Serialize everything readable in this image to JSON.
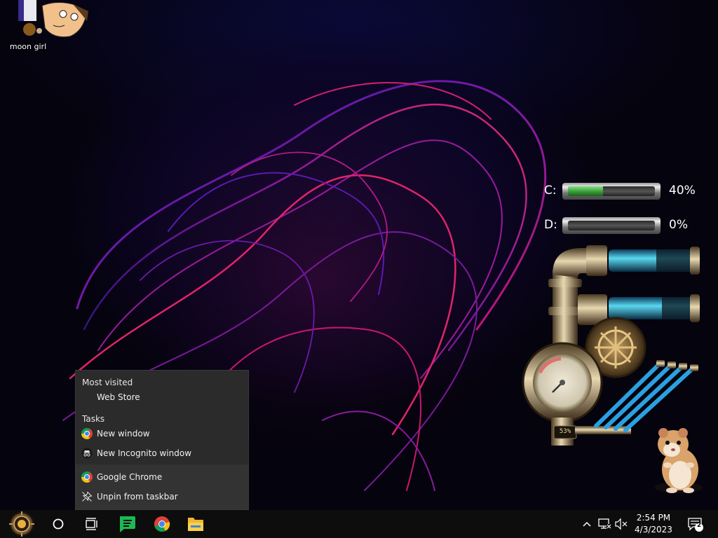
{
  "desktop": {
    "icons": [
      {
        "label": "moon girl",
        "icon": "cartoon-character-icon"
      }
    ]
  },
  "drives": [
    {
      "letter": "C:",
      "percent_text": "40%",
      "used_fraction": 0.4
    },
    {
      "letter": "D:",
      "percent_text": "0%",
      "used_fraction": 0.0
    }
  ],
  "gadget": {
    "readout": "53%"
  },
  "jumplist": {
    "most_visited_heading": "Most visited",
    "most_visited": [
      {
        "label": "Web Store"
      }
    ],
    "tasks_heading": "Tasks",
    "tasks": [
      {
        "label": "New window",
        "icon": "chrome-icon"
      },
      {
        "label": "New Incognito window",
        "icon": "incognito-icon"
      }
    ],
    "app_label": "Google Chrome",
    "unpin_label": "Unpin from taskbar"
  },
  "taskbar": {
    "start_icon": "steampunk-start-orb-icon",
    "search_icon": "cortana-circle-icon",
    "taskview_icon": "task-view-icon",
    "apps": [
      {
        "name": "spotify-like-green-app-icon"
      },
      {
        "name": "chrome-icon"
      },
      {
        "name": "file-explorer-icon"
      }
    ],
    "tray": {
      "chevron_icon": "chevron-up-icon",
      "network_icon": "network-icon",
      "volume_icon": "volume-muted-icon",
      "time": "2:54 PM",
      "date": "4/3/2023",
      "notifications_count": "2"
    }
  },
  "colors": {
    "taskbar_bg": "#0d0d0d",
    "jumplist_bg": "#2b2b2b",
    "wallpaper_accent": "#c0179a"
  }
}
